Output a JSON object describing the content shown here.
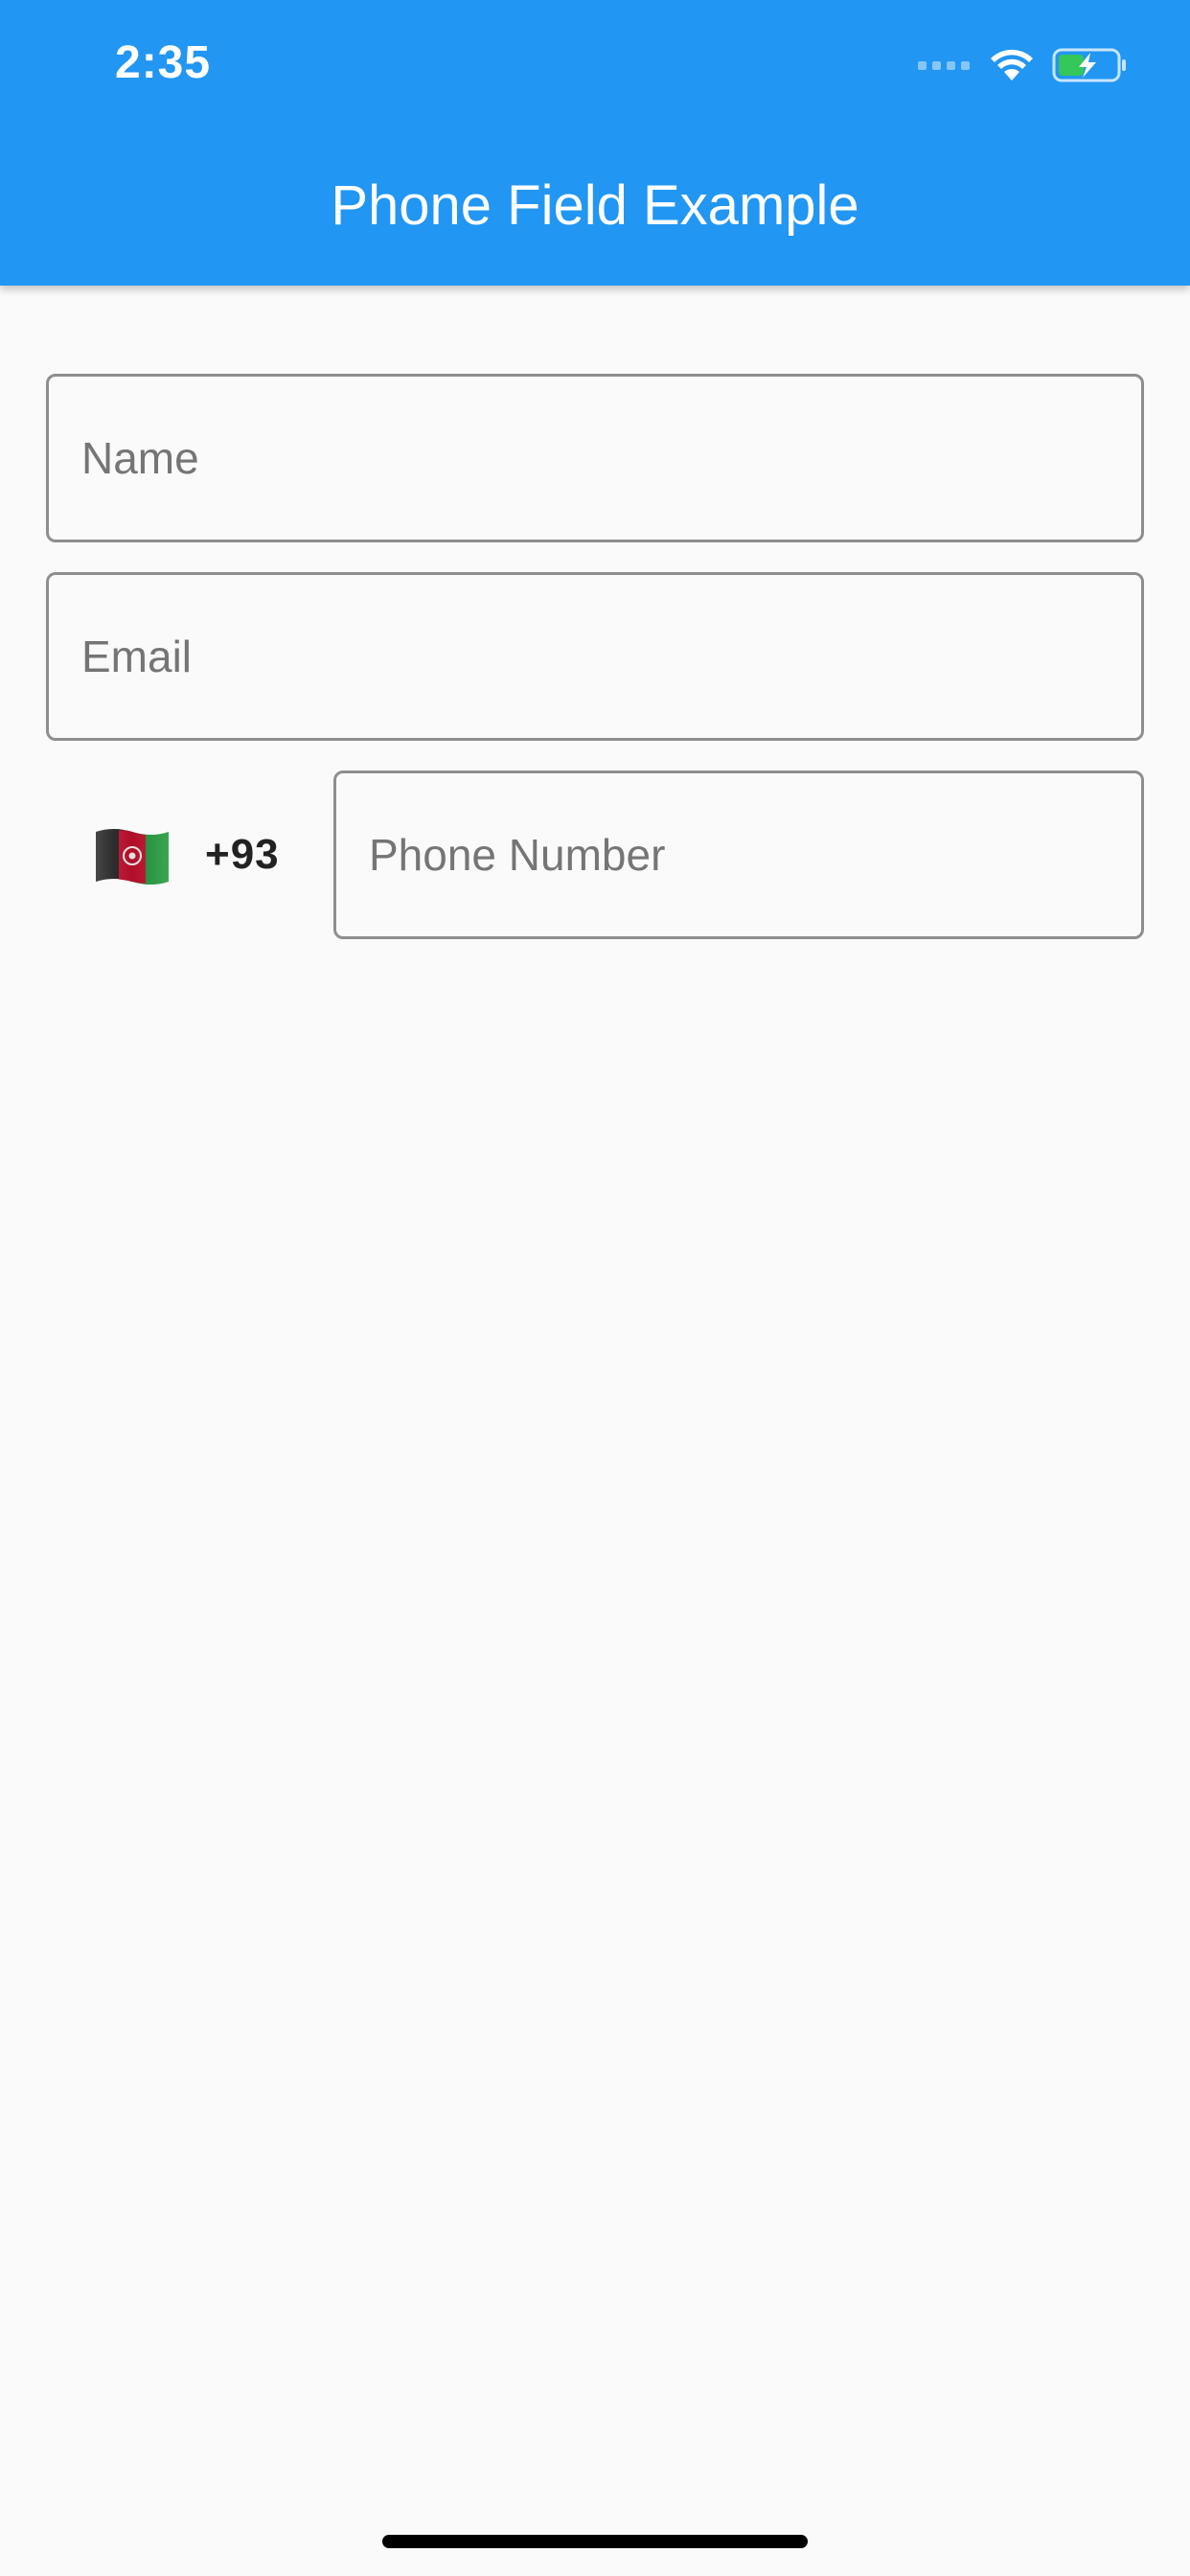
{
  "status_bar": {
    "time": "2:35",
    "icons": [
      "signal-dots-icon",
      "wifi-icon",
      "battery-charging-icon"
    ]
  },
  "app_bar": {
    "title": "Phone Field Example",
    "background_color": "#2196f3"
  },
  "form": {
    "name_field": {
      "placeholder": "Name",
      "value": ""
    },
    "email_field": {
      "placeholder": "Email",
      "value": ""
    },
    "phone": {
      "country_flag": "afghanistan-flag-icon",
      "dial_code": "+93",
      "placeholder": "Phone Number",
      "value": ""
    }
  },
  "colors": {
    "accent": "#2196f3",
    "background": "#fafafa",
    "field_border": "#8e8e8e",
    "placeholder_text": "#757575",
    "battery_fill": "#34c759"
  }
}
